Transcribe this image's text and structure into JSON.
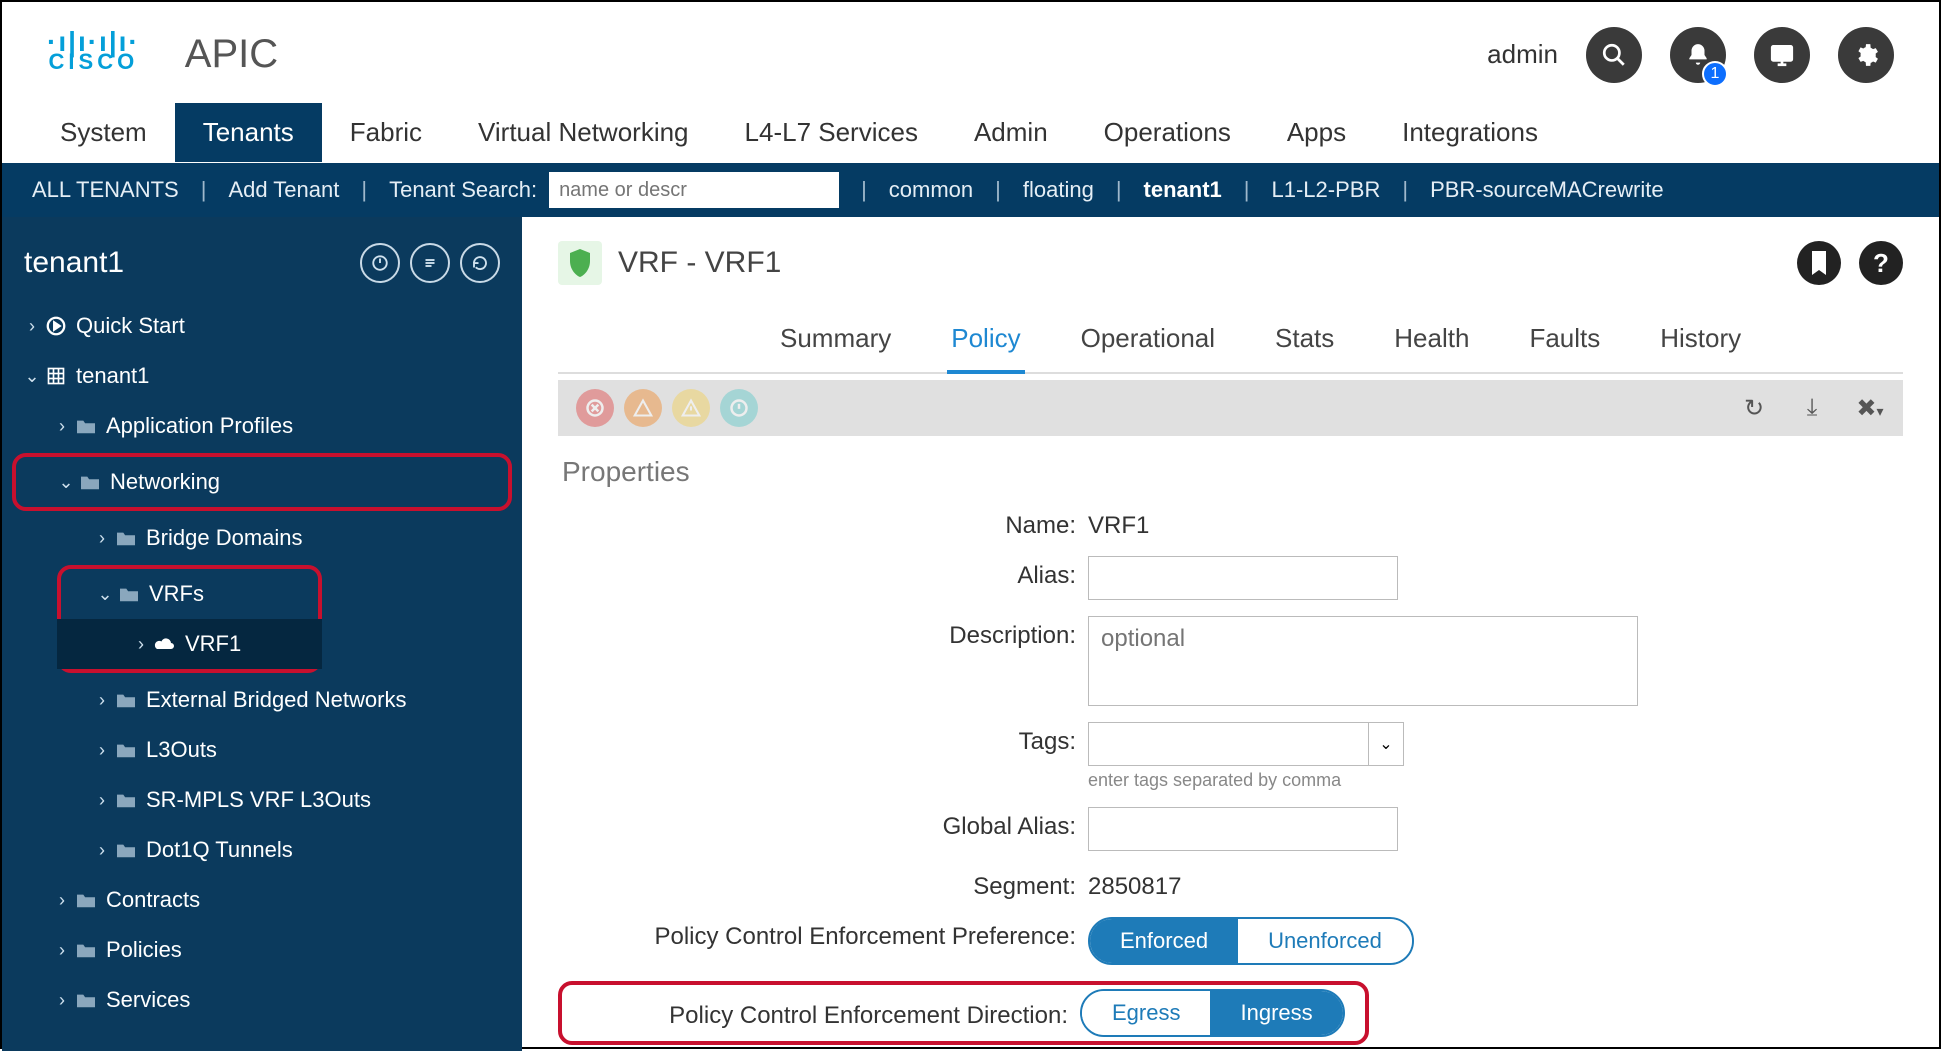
{
  "header": {
    "logo_text": "CISCO",
    "app_title": "APIC",
    "user": "admin",
    "notif_badge": "1"
  },
  "mainnav": [
    "System",
    "Tenants",
    "Fabric",
    "Virtual Networking",
    "L4-L7 Services",
    "Admin",
    "Operations",
    "Apps",
    "Integrations"
  ],
  "mainnav_active": 1,
  "subnav": {
    "all": "ALL TENANTS",
    "add": "Add Tenant",
    "search_label": "Tenant Search:",
    "search_placeholder": "name or descr",
    "links": [
      "common",
      "floating",
      "tenant1",
      "L1-L2-PBR",
      "PBR-sourceMACrewrite"
    ],
    "bold_link_index": 2
  },
  "sidebar": {
    "title": "tenant1",
    "tree": {
      "quick_start": "Quick Start",
      "root": "tenant1",
      "app_profiles": "Application Profiles",
      "networking": "Networking",
      "bridge_domains": "Bridge Domains",
      "vrfs": "VRFs",
      "vrf1": "VRF1",
      "ext_bridged": "External Bridged Networks",
      "l3outs": "L3Outs",
      "srmpls": "SR-MPLS VRF L3Outs",
      "dot1q": "Dot1Q Tunnels",
      "contracts": "Contracts",
      "policies": "Policies",
      "services": "Services"
    }
  },
  "content": {
    "title": "VRF - VRF1",
    "tabs": [
      "Summary",
      "Policy",
      "Operational",
      "Stats",
      "Health",
      "Faults",
      "History"
    ],
    "active_tab": 1,
    "section_title": "Properties",
    "fields": {
      "name_label": "Name:",
      "name_value": "VRF1",
      "alias_label": "Alias:",
      "alias_value": "",
      "desc_label": "Description:",
      "desc_placeholder": "optional",
      "tags_label": "Tags:",
      "tags_hint": "enter tags separated by comma",
      "galias_label": "Global Alias:",
      "galias_value": "",
      "segment_label": "Segment:",
      "segment_value": "2850817",
      "pcep_label": "Policy Control Enforcement Preference:",
      "pcep_opt1": "Enforced",
      "pcep_opt2": "Unenforced",
      "pced_label": "Policy Control Enforcement Direction:",
      "pced_opt1": "Egress",
      "pced_opt2": "Ingress"
    }
  }
}
